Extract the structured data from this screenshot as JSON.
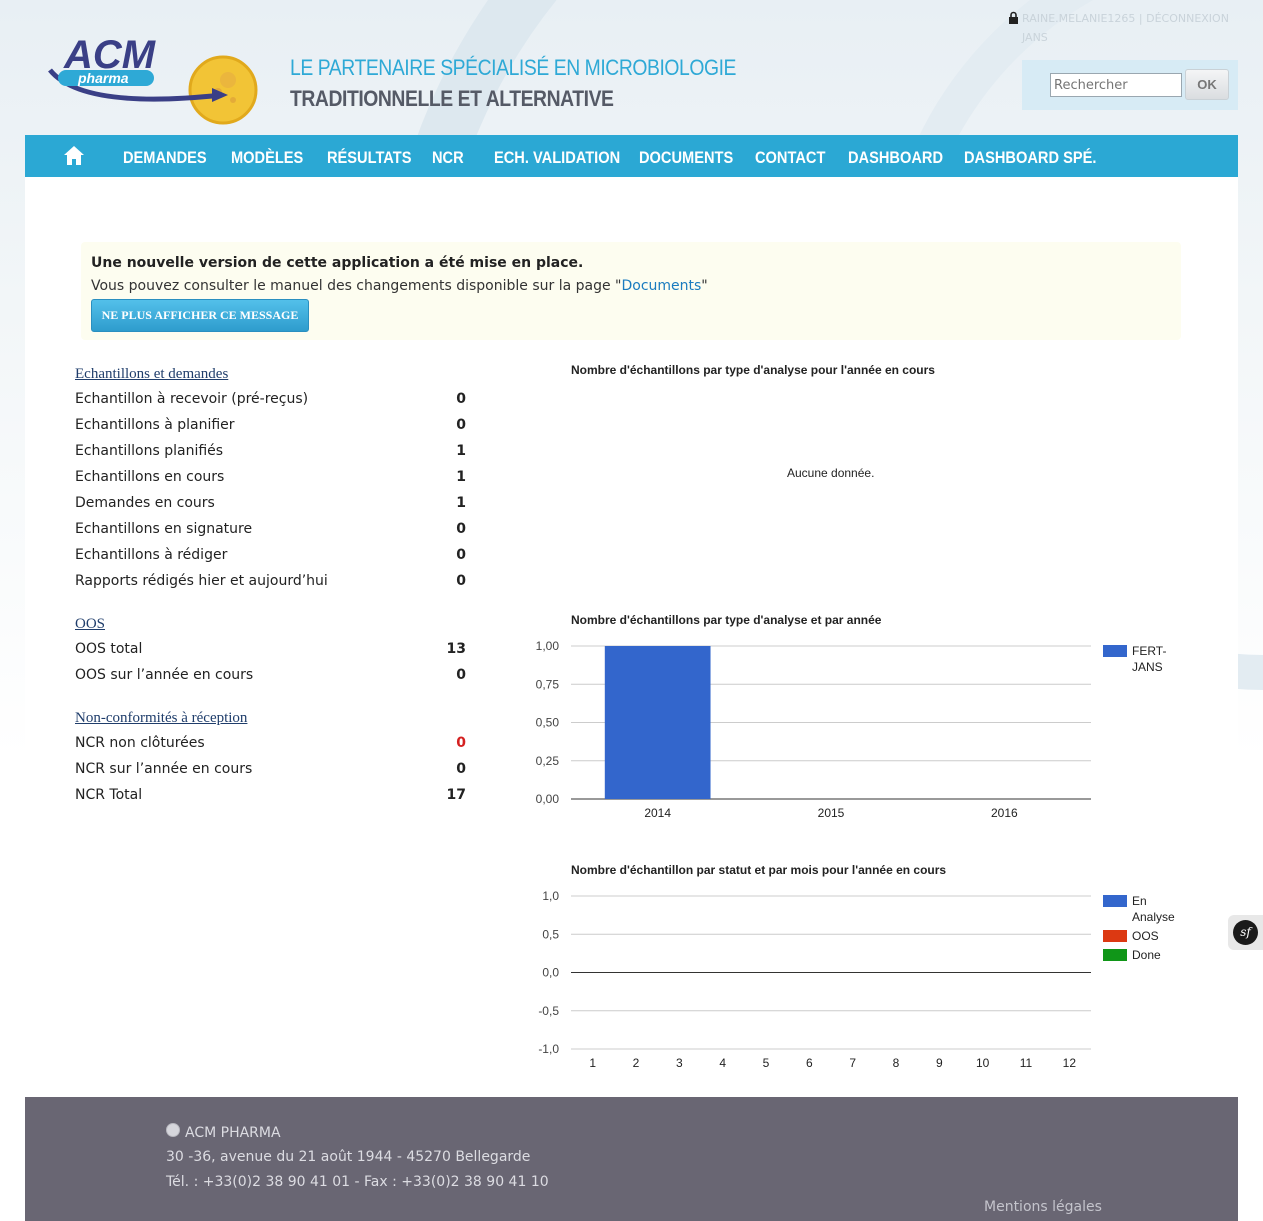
{
  "header": {
    "tagline_line1": "LE PARTENAIRE SPÉCIALISÉ EN MICROBIOLOGIE",
    "tagline_line2": "TRADITIONNELLE ET ALTERNATIVE",
    "logo_text": "ACM",
    "logo_sub": "pharma",
    "user_text": "RAINE.MELANIE1265 | DÉCONNEXION",
    "user_text2": "JANS"
  },
  "search": {
    "placeholder": "Rechercher",
    "button": "OK"
  },
  "nav": {
    "items": [
      "DEMANDES",
      "MODÈLES",
      "RÉSULTATS",
      "NCR",
      "ECH. VALIDATION",
      "DOCUMENTS",
      "CONTACT",
      "DASHBOARD",
      "DASHBOARD SPÉ."
    ]
  },
  "notice": {
    "title": "Une nouvelle version de cette application a été mise en place.",
    "text_before": "Vous pouvez consulter le manuel des changements disponible sur la page \"",
    "link": "Documents",
    "text_after": "\"",
    "button": "NE PLUS AFFICHER CE MESSAGE"
  },
  "stats": {
    "sections": [
      {
        "title": "Echantillons et demandes",
        "rows": [
          {
            "label": "Echantillon à recevoir (pré-reçus)",
            "value": "0"
          },
          {
            "label": "Echantillons à planifier",
            "value": "0"
          },
          {
            "label": "Echantillons planifiés",
            "value": "1"
          },
          {
            "label": "Echantillons en cours",
            "value": "1"
          },
          {
            "label": "Demandes en cours",
            "value": "1"
          },
          {
            "label": "Echantillons en signature",
            "value": "0"
          },
          {
            "label": "Echantillons à rédiger",
            "value": "0"
          },
          {
            "label": "Rapports rédigés hier et aujourd’hui",
            "value": "0"
          }
        ]
      },
      {
        "title": "OOS",
        "rows": [
          {
            "label": "OOS total",
            "value": "13"
          },
          {
            "label": "OOS sur l’année en cours",
            "value": "0"
          }
        ]
      },
      {
        "title": "Non-conformités à réception",
        "rows": [
          {
            "label": "NCR non clôturées",
            "value": "0",
            "color": "#d42020"
          },
          {
            "label": "NCR sur l’année en cours",
            "value": "0"
          },
          {
            "label": "NCR Total",
            "value": "17"
          }
        ]
      }
    ]
  },
  "chart1": {
    "title": "Nombre d'échantillons par type d'analyse pour l'année en cours",
    "empty_text": "Aucune donnée."
  },
  "chart_data": [
    {
      "type": "bar",
      "title": "Nombre d'échantillons par type d'analyse et par année",
      "categories": [
        "2014",
        "2015",
        "2016"
      ],
      "series": [
        {
          "name": "FERT-JANS",
          "values": [
            1,
            0,
            0
          ],
          "color": "#3366cc"
        }
      ],
      "ylim": [
        0,
        1
      ],
      "yticks": [
        "0,00",
        "0,25",
        "0,50",
        "0,75",
        "1,00"
      ],
      "legend": "right"
    },
    {
      "type": "line",
      "title": "Nombre d'échantillon par statut et par mois pour l'année en cours",
      "categories": [
        "1",
        "2",
        "3",
        "4",
        "5",
        "6",
        "7",
        "8",
        "9",
        "10",
        "11",
        "12"
      ],
      "series": [
        {
          "name": "En Analyse",
          "values": [
            0,
            0,
            0,
            0,
            0,
            0,
            0,
            0,
            0,
            0,
            0,
            0
          ],
          "color": "#3366cc"
        },
        {
          "name": "OOS",
          "values": [
            0,
            0,
            0,
            0,
            0,
            0,
            0,
            0,
            0,
            0,
            0,
            0
          ],
          "color": "#dc3912"
        },
        {
          "name": "Done",
          "values": [
            0,
            0,
            0,
            0,
            0,
            0,
            0,
            0,
            0,
            0,
            0,
            0
          ],
          "color": "#109618"
        }
      ],
      "ylim": [
        -1,
        1
      ],
      "yticks": [
        "-1,0",
        "-0,5",
        "0,0",
        "0,5",
        "1,0"
      ],
      "legend": "right"
    }
  ],
  "footer": {
    "company": "ACM PHARMA",
    "address": "30 -36, avenue du 21 août 1944 - 45270 Bellegarde",
    "phone": "Tél. : +33(0)2 38 90 41 01 - Fax : +33(0)2 38 90 41 10",
    "legal": "Mentions légales"
  },
  "symfony_badge": "sf"
}
